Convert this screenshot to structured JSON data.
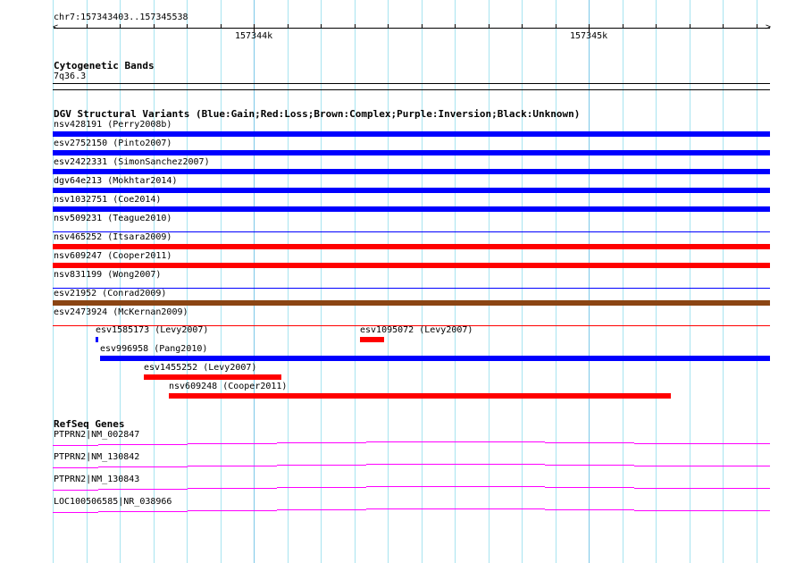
{
  "ruler": {
    "range_label": "chr7:157343403..157345538",
    "tick_labels": [
      "157344k",
      "157345k"
    ]
  },
  "cytobands": {
    "title": "Cytogenetic Bands",
    "band": "7q36.3"
  },
  "dgv": {
    "title": "DGV Structural Variants (Blue:Gain;Red:Loss;Brown:Complex;Purple:Inversion;Black:Unknown)",
    "colors": {
      "gain": "#0000ff",
      "loss": "#ff0000",
      "complex": "#8b4513"
    },
    "rows": [
      {
        "label": "nsv428191 (Perry2008b)",
        "type": "gain"
      },
      {
        "label": "esv2752150 (Pinto2007)",
        "type": "gain"
      },
      {
        "label": "esv2422331 (SimonSanchez2007)",
        "type": "gain"
      },
      {
        "label": "dgv64e213 (Mokhtar2014)",
        "type": "gain"
      },
      {
        "label": "nsv1032751 (Coe2014)",
        "type": "gain"
      },
      {
        "label": "nsv509231 (Teague2010)",
        "type": "gain"
      },
      {
        "label": "nsv465252 (Itsara2009)",
        "type": "loss"
      },
      {
        "label": "nsv609247 (Cooper2011)",
        "type": "loss"
      },
      {
        "label": "nsv831199 (Wong2007)",
        "type": "gain"
      },
      {
        "label": "esv21952 (Conrad2009)",
        "type": "complex"
      },
      {
        "label": "esv2473924 (McKernan2009)",
        "type": "loss"
      }
    ],
    "packed": [
      {
        "label": "esv1585173 (Levy2007)",
        "type": "gain"
      },
      {
        "label": "esv1095072 (Levy2007)",
        "type": "loss"
      },
      {
        "label": "esv996958 (Pang2010)",
        "type": "gain"
      },
      {
        "label": "esv1455252 (Levy2007)",
        "type": "loss"
      },
      {
        "label": "nsv609248 (Cooper2011)",
        "type": "loss"
      }
    ]
  },
  "refseq": {
    "title": "RefSeq Genes",
    "color": "#ff00ff",
    "genes": [
      {
        "label": "PTPRN2|NM_002847"
      },
      {
        "label": "PTPRN2|NM_130842"
      },
      {
        "label": "PTPRN2|NM_130843"
      },
      {
        "label": "LOC100506585|NR_038966"
      }
    ]
  }
}
